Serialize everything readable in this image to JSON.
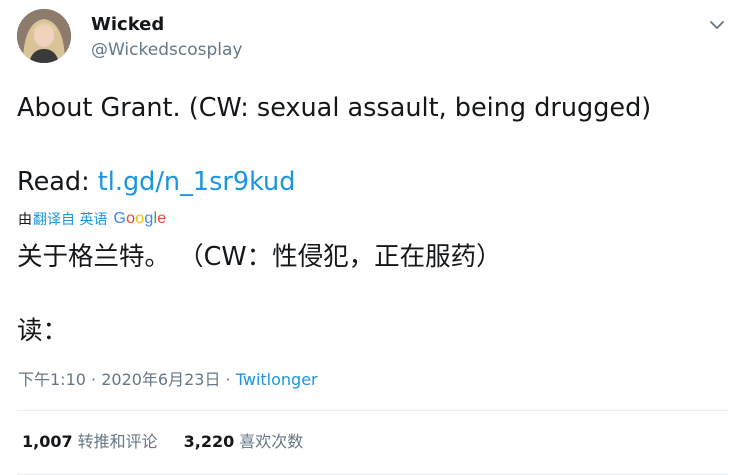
{
  "author": {
    "display_name": "Wicked",
    "handle": "@Wickedscosplay"
  },
  "tweet": {
    "text_main": "About Grant. (CW: sexual assault, being drugged)",
    "read_label": "Read: ",
    "read_link": "tl.gd/n_1sr9kud"
  },
  "translation": {
    "prefix": "由",
    "link_label": "翻译自 英语",
    "provider": "Google",
    "text_main": "关于格兰特。 （CW：性侵犯，正在服药）",
    "text_read": "读："
  },
  "meta": {
    "time": "下午1:10",
    "separator": " · ",
    "date": "2020年6月23日",
    "source": "Twitlonger"
  },
  "stats": {
    "retweets_count": "1,007",
    "retweets_label": "转推和评论",
    "likes_count": "3,220",
    "likes_label": "喜欢次数"
  },
  "colors": {
    "text": "#14171a",
    "secondary": "#657786",
    "link": "#1b95e0",
    "divider": "#e6ecf0"
  },
  "icons": {
    "menu": "chevron-down-icon",
    "avatar": "profile-photo"
  }
}
